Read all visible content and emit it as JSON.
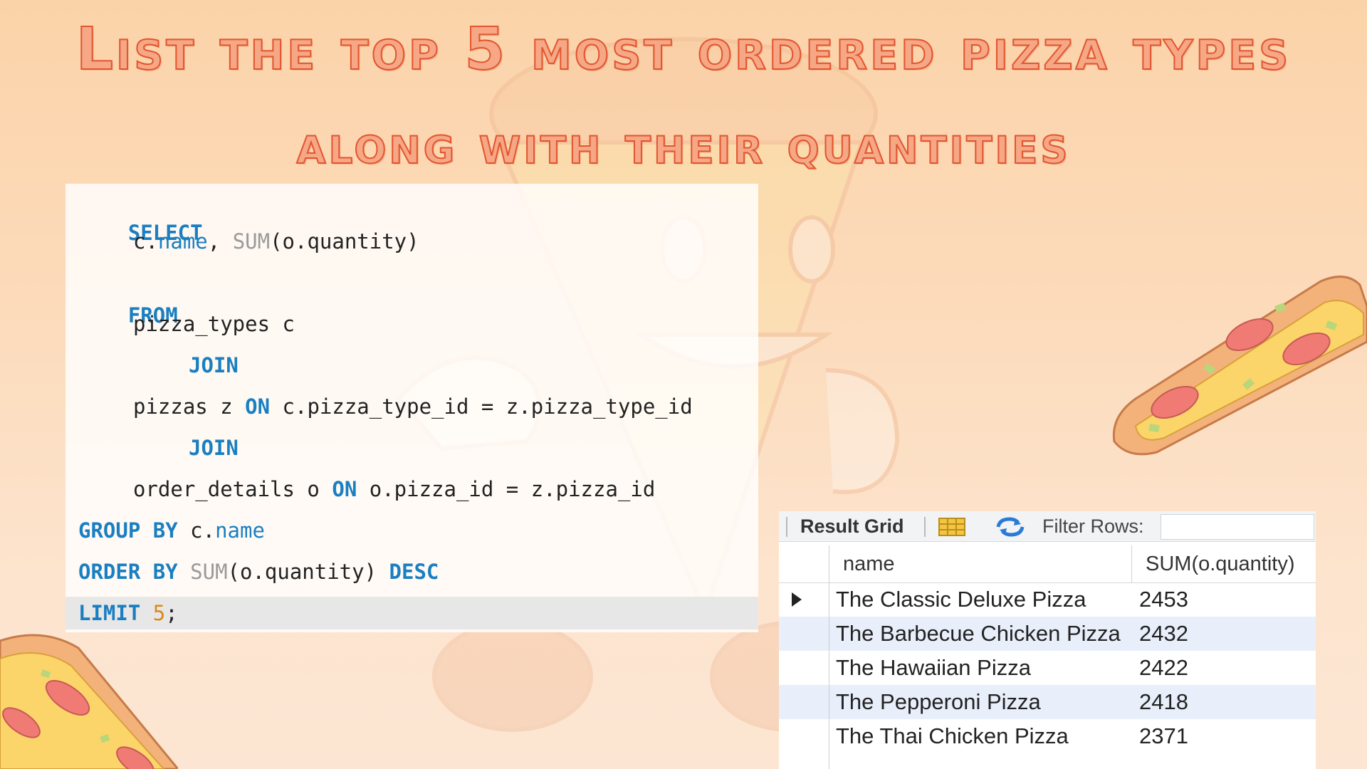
{
  "title": {
    "line1": "List the top 5 most ordered pizza types",
    "line2": "along with their quantities"
  },
  "code": {
    "select": "SELECT",
    "line2_a": "c.",
    "line2_b": "name",
    "line2_c": ", ",
    "line2_fn": "SUM",
    "line2_d": "(o.quantity)",
    "from": "FROM",
    "line4": "pizza_types c",
    "join1": "JOIN",
    "line6_a": "pizzas z ",
    "line6_on": "ON",
    "line6_b": " c.pizza_type_id = z.pizza_type_id",
    "join2": "JOIN",
    "line8_a": "order_details o ",
    "line8_on": "ON",
    "line8_b": " o.pizza_id = z.pizza_id",
    "group_by": "GROUP BY",
    "line9_b": " c.",
    "line9_col": "name",
    "order_by": "ORDER BY",
    "line10_fn": "SUM",
    "line10_b": "(o.quantity) ",
    "desc": "DESC",
    "limit": "LIMIT",
    "limit_val": "5",
    "limit_end": ";"
  },
  "result_grid": {
    "toolbar": {
      "result_grid_label": "Result Grid",
      "filter_label": "Filter Rows:",
      "filter_value": ""
    },
    "columns": [
      "name",
      "SUM(o.quantity)"
    ],
    "rows": [
      {
        "name": "The Classic Deluxe Pizza",
        "sum": "2453"
      },
      {
        "name": "The Barbecue Chicken Pizza",
        "sum": "2432"
      },
      {
        "name": "The Hawaiian Pizza",
        "sum": "2422"
      },
      {
        "name": "The Pepperoni Pizza",
        "sum": "2418"
      },
      {
        "name": "The Thai Chicken Pizza",
        "sum": "2371"
      }
    ]
  },
  "colors": {
    "title_fill": "#f6a785",
    "title_stroke": "#e2552f",
    "keyword": "#1a7fc1",
    "function": "#9a9a9a",
    "number": "#d98a1a",
    "row_alt": "#e8effa"
  },
  "icons": [
    "grid-icon",
    "refresh-icon",
    "row-pointer-icon",
    "pizza-slice-icon"
  ]
}
